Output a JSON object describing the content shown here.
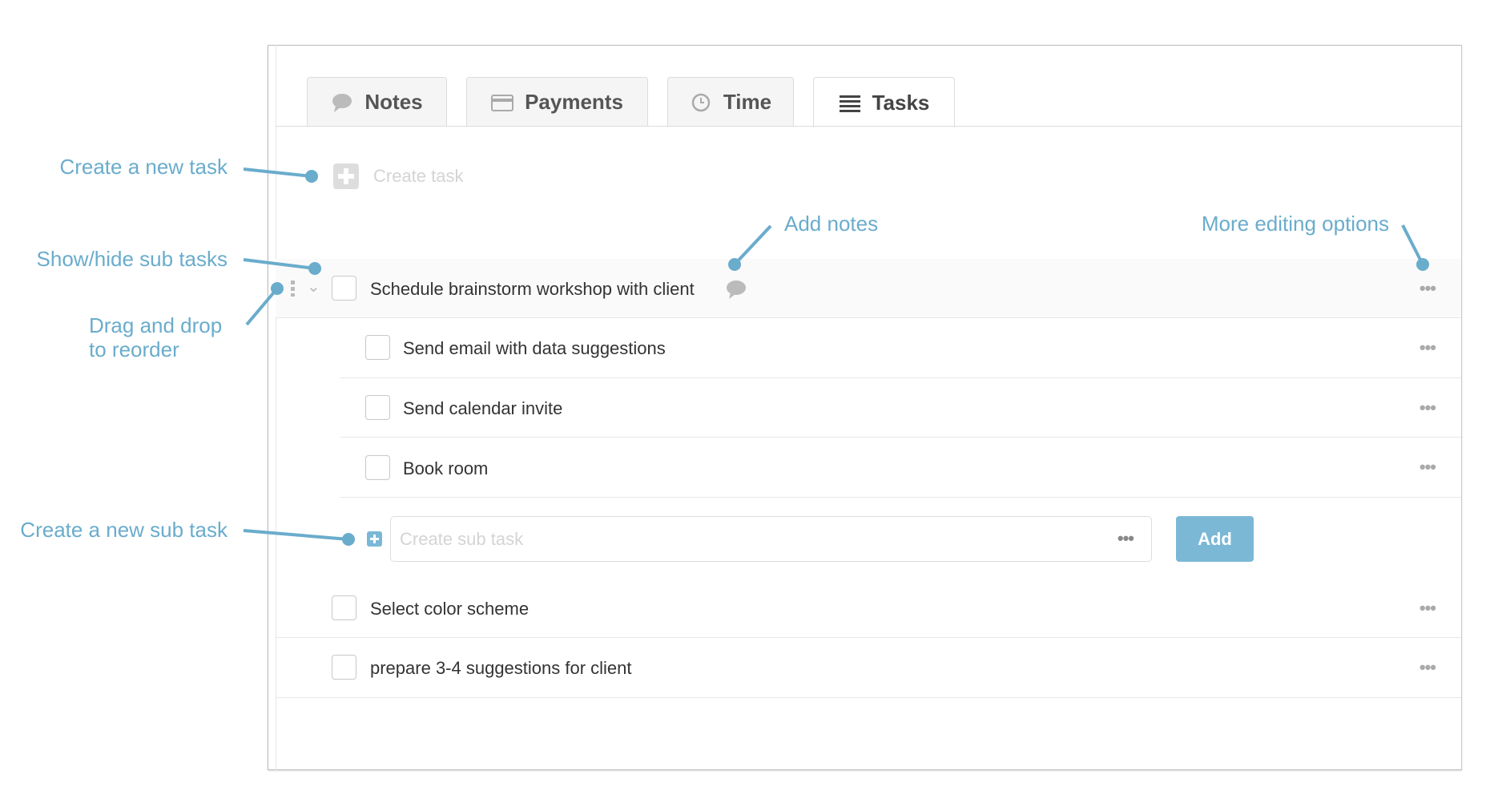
{
  "tabs": [
    {
      "label": "Notes",
      "icon": "speech-bubble-icon"
    },
    {
      "label": "Payments",
      "icon": "credit-card-icon"
    },
    {
      "label": "Time",
      "icon": "clock-icon"
    },
    {
      "label": "Tasks",
      "icon": "list-icon",
      "active": true
    }
  ],
  "create_task": {
    "placeholder": "Create task"
  },
  "tasks": [
    {
      "label": "Schedule brainstorm workshop with client",
      "has_note": true,
      "expanded": true,
      "subtasks": [
        {
          "label": "Send email with data suggestions"
        },
        {
          "label": "Send calendar invite"
        },
        {
          "label": "Book room"
        }
      ]
    },
    {
      "label": "Select color scheme"
    },
    {
      "label": "prepare 3-4 suggestions for client"
    }
  ],
  "create_subtask": {
    "placeholder": "Create sub task",
    "add_label": "Add"
  },
  "more_label": "•••",
  "annotations": {
    "create_task": "Create a new task",
    "show_hide": "Show/hide sub tasks",
    "drag_1": "Drag and drop",
    "drag_2": "to reorder",
    "create_subtask": "Create a new sub task",
    "add_notes": "Add notes",
    "more_options": "More editing options"
  },
  "colors": {
    "annotation": "#6aaccc",
    "add_button": "#7bb8d6",
    "row_highlight": "#fafafa"
  }
}
